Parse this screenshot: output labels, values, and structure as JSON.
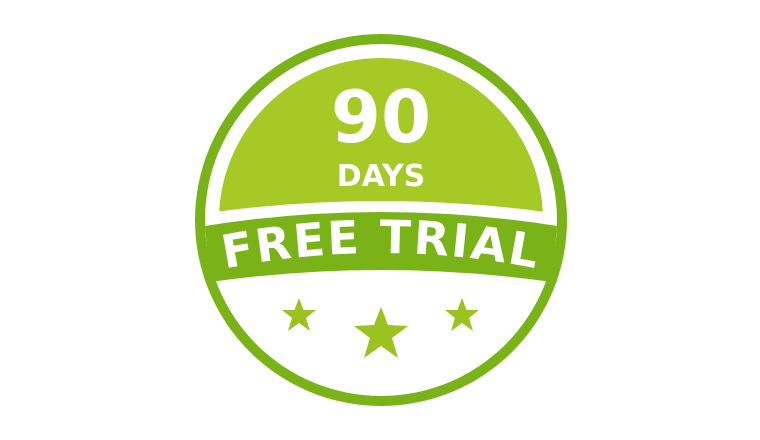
{
  "badge": {
    "number": "90",
    "unit": "DAYS",
    "banner_text": "FREE TRIAL",
    "stars_count": 3
  },
  "colors": {
    "primary_green": "#7ab317",
    "light_green": "#a7c925",
    "star_green": "#9cc21f",
    "white": "#ffffff"
  }
}
